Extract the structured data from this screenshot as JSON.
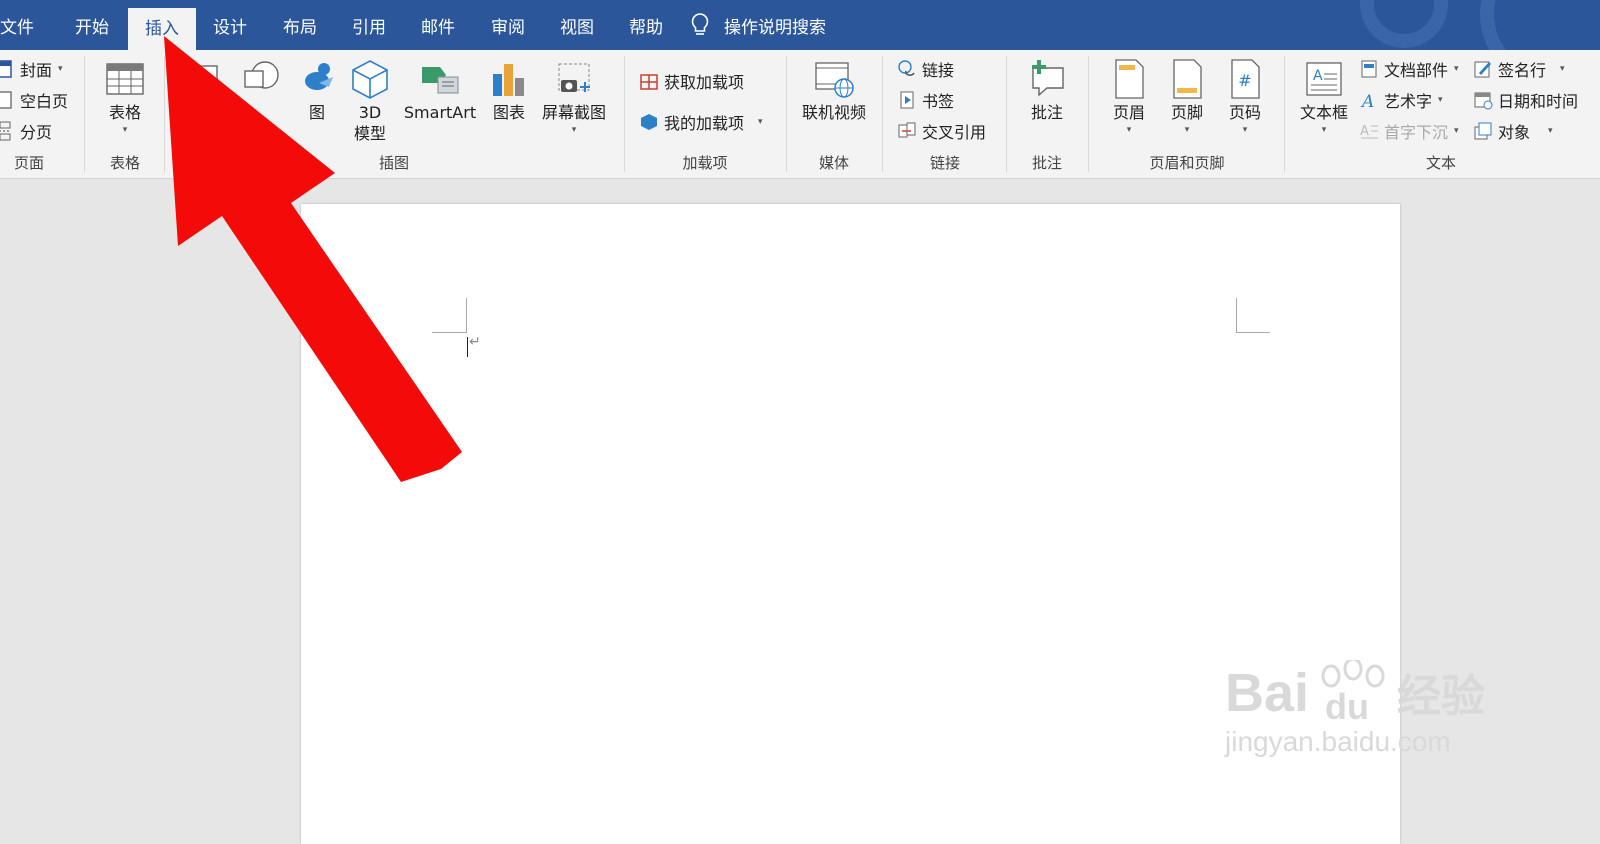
{
  "tabs": [
    {
      "label": "文件",
      "active": false
    },
    {
      "label": "开始",
      "active": false
    },
    {
      "label": "插入",
      "active": true
    },
    {
      "label": "设计",
      "active": false
    },
    {
      "label": "布局",
      "active": false
    },
    {
      "label": "引用",
      "active": false
    },
    {
      "label": "邮件",
      "active": false
    },
    {
      "label": "审阅",
      "active": false
    },
    {
      "label": "视图",
      "active": false
    },
    {
      "label": "帮助",
      "active": false
    }
  ],
  "tell_me": {
    "label": "操作说明搜索",
    "icon": "lightbulb-icon"
  },
  "groups": {
    "pages": {
      "label": "页面",
      "cover": "封面",
      "blank_page": "空白页",
      "page_break": "分页"
    },
    "tables": {
      "label": "表格",
      "table": "表格"
    },
    "illustrations": {
      "label": "插图",
      "picture_partial": "",
      "icons_partial": "图",
      "models_3d": [
        "3D",
        "模型"
      ],
      "smartart": "SmartArt",
      "chart": "图表",
      "screenshot": "屏幕截图"
    },
    "addins": {
      "label": "加载项",
      "get_addins": "获取加载项",
      "my_addins": "我的加载项"
    },
    "media": {
      "label": "媒体",
      "online_video": "联机视频"
    },
    "links": {
      "label": "链接",
      "link": "链接",
      "bookmark": "书签",
      "cross_reference": "交叉引用"
    },
    "comments": {
      "label": "批注",
      "comment": "批注"
    },
    "header_footer": {
      "label": "页眉和页脚",
      "header": "页眉",
      "footer": "页脚",
      "page_number": "页码"
    },
    "text": {
      "label": "文本",
      "text_box": "文本框",
      "quick_parts": "文档部件",
      "wordart": "艺术字",
      "drop_cap": "首字下沉",
      "signature_line": "签名行",
      "date_time": "日期和时间",
      "object": "对象"
    }
  },
  "document": {
    "paragraph_mark": "↵"
  },
  "watermark": {
    "brand": "Bai",
    "paw_text": "du",
    "cn": "经验",
    "url": "jingyan.baidu.com"
  },
  "colors": {
    "tabbar": "#2b579a",
    "ribbon": "#f3f3f3",
    "arrow": "#f50a0a",
    "canvas": "#e6e6e6"
  }
}
